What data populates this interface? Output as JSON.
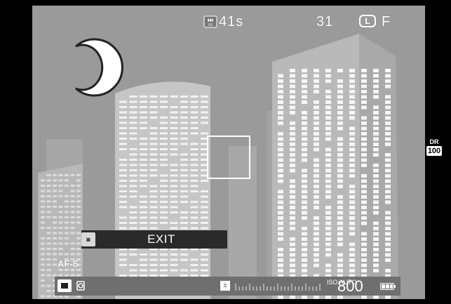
{
  "status_top": {
    "shots_remaining": "41s",
    "frame_count": "31",
    "image_size": "L",
    "image_quality": "F"
  },
  "exit_prompt": {
    "label": "EXIT"
  },
  "focus_mode": "AF-S",
  "bottom_info": {
    "iso_label": "ISO AUTO",
    "iso_value": "800"
  },
  "dynamic_range": {
    "label": "DR",
    "value": "100"
  },
  "icons": {
    "scene_mode": "night-moon-icon",
    "shooting_mode": "single-frame-icon",
    "metering": "multi-metering-icon",
    "exposure_comp": "exposure-compensation-icon",
    "battery": "battery-icon"
  },
  "colors": {
    "sky": "#9a9a9a",
    "building_left": "#c4c4c4",
    "building_right": "#b6b6b6",
    "overlay_bar": "#2a2a2a",
    "bottom_bar": "#6f6f6f"
  }
}
